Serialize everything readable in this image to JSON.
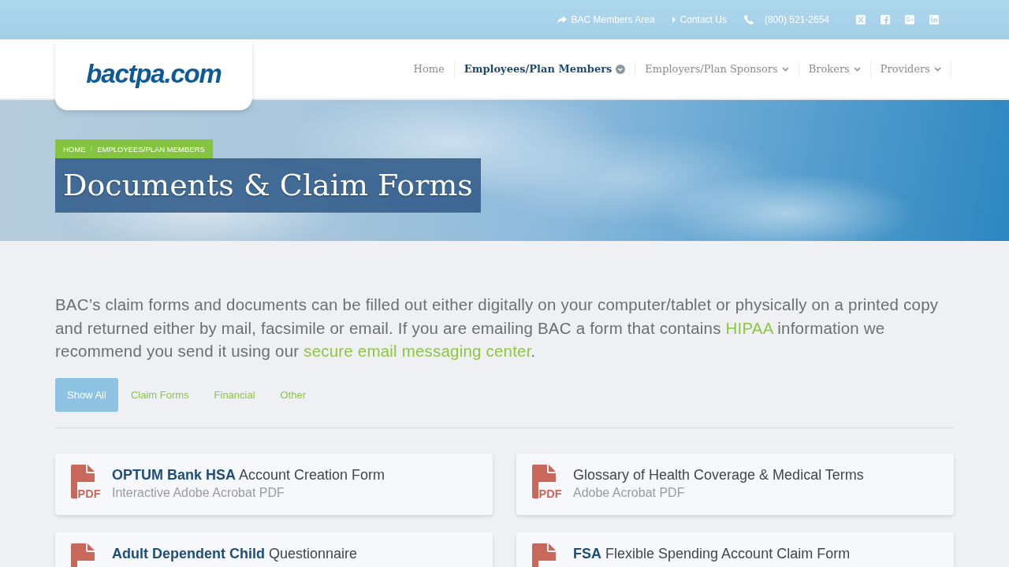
{
  "top_bar": {
    "links": [
      {
        "kind": "members",
        "label": "BAC Members Area"
      },
      {
        "kind": "contact",
        "label": "Contact Us"
      },
      {
        "kind": "phone",
        "label": "(800) 521-2654"
      }
    ]
  },
  "header": {
    "logo": "bactpa.com",
    "nav": [
      {
        "label": "Home",
        "selected": false,
        "dropdown": false
      },
      {
        "label": "Employees/Plan Members",
        "selected": true,
        "dropdown": true
      },
      {
        "label": "Employers/Plan Sponsors",
        "selected": false,
        "dropdown": true
      },
      {
        "label": "Brokers",
        "selected": false,
        "dropdown": true
      },
      {
        "label": "Providers",
        "selected": false,
        "dropdown": true
      }
    ]
  },
  "hero": {
    "breadcrumb": {
      "items": [
        "HOME",
        "EMPLOYEES/PLAN MEMBERS"
      ],
      "separator": "/"
    },
    "title": "Documents & Claim Forms"
  },
  "intro": [
    {
      "kind": "text",
      "text": "BAC’s claim forms and documents can be filled out either digitally on your computer/tablet or physically on a printed copy and returned either by mail, facsimile or email. If you are emailing BAC a form that contains "
    },
    {
      "kind": "link",
      "text": "HIPAA"
    },
    {
      "kind": "text",
      "text": " information we recommend you send it using our "
    },
    {
      "kind": "link",
      "text": "secure email messaging center"
    },
    {
      "kind": "text",
      "text": "."
    }
  ],
  "filters": [
    {
      "label": "Show All",
      "selected": true
    },
    {
      "label": "Claim Forms",
      "selected": false
    },
    {
      "label": "Financial",
      "selected": false
    },
    {
      "label": "Other",
      "selected": false
    }
  ],
  "documents": [
    {
      "title": "**OPTUM Bank HSA** Account Creation Form",
      "subtitle": "Interactive Adobe Acrobat PDF",
      "badge": "PDF"
    },
    {
      "title": "Glossary of Health Coverage & Medical Terms",
      "subtitle": "Adobe Acrobat PDF",
      "badge": "PDF"
    },
    {
      "title": "**Adult Dependent Child** Questionnaire"
    },
    {
      "title": "**FSA** Flexible Spending Account Claim Form"
    }
  ]
}
